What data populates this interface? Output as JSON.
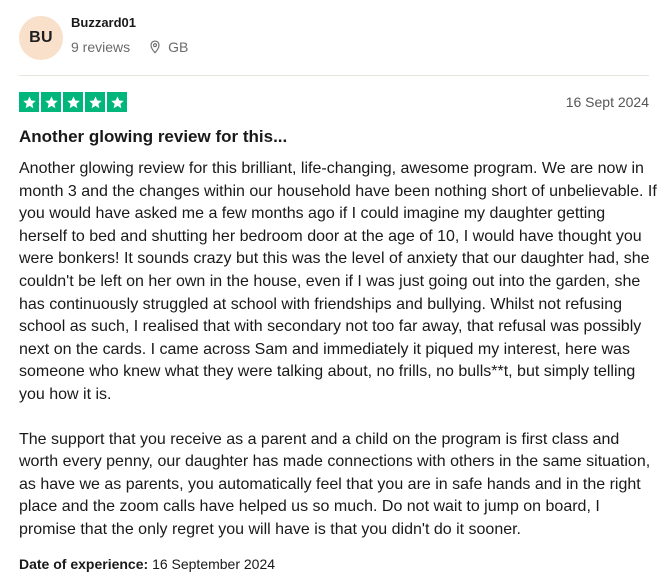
{
  "reviewer": {
    "initials": "BU",
    "name": "Buzzard01",
    "reviews_count": "9 reviews",
    "country": "GB"
  },
  "rating": {
    "stars": 5,
    "max_stars": 5,
    "star_color": "#00b67a"
  },
  "review": {
    "date": "16 Sept 2024",
    "title": "Another glowing review for this...",
    "paragraphs": [
      "Another glowing review for this brilliant, life-changing, awesome program. We are now in month 3 and the changes within our household have been nothing short of unbelievable. If you would have asked me a few months ago if I could imagine my daughter getting herself to bed and shutting her bedroom door at the age of 10, I would have thought you were bonkers! It sounds crazy but this was the level of anxiety that our daughter had, she couldn't be left on her own in the house, even if I was just going out into the garden, she has continuously struggled at school with friendships and bullying. Whilst not refusing school as such, I realised that with secondary not too far away, that refusal was possibly next on the cards. I came across Sam and immediately it piqued my interest, here was someone who knew what they were talking about, no frills, no bulls**t, but simply telling you how it is.",
      "The support that you receive as a parent and a child on the program is first class and worth every penny, our daughter has made connections with others in the same situation, as have we as parents, you automatically feel that you are in safe hands and in the right place and the zoom calls have helped us so much. Do not wait to jump on board, I promise that the only regret you will have is that you didn't do it sooner."
    ],
    "experience_label": "Date of experience:",
    "experience_date": "16 September 2024"
  },
  "icons": {
    "location": "location-pin-icon",
    "star": "star-icon"
  }
}
